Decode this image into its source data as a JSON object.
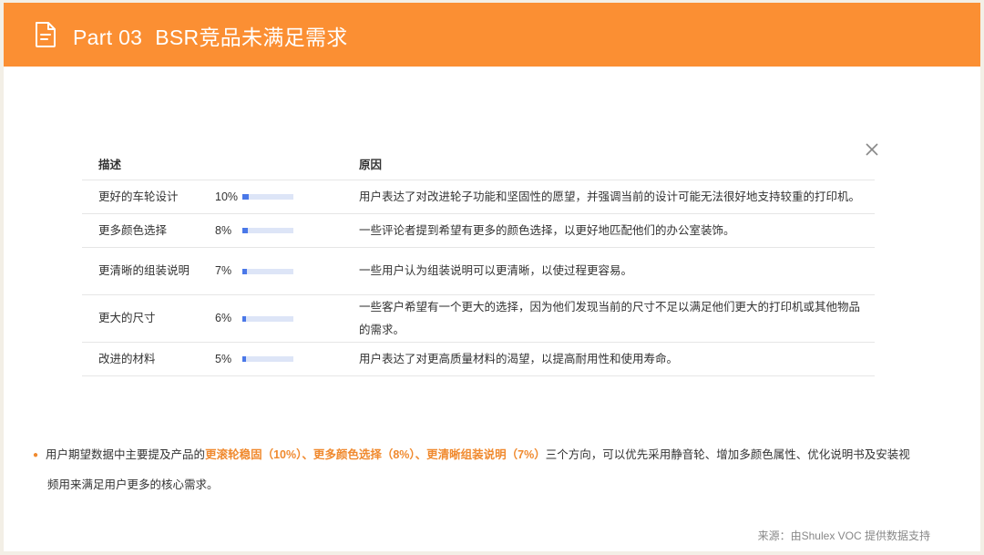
{
  "header": {
    "part_label": "Part 03",
    "title": "BSR竞品未满足需求",
    "icon": "document-icon",
    "background_color": "#fb8f33"
  },
  "table": {
    "headers": {
      "description": "描述",
      "reason": "原因"
    },
    "rows": [
      {
        "description": "更好的车轮设计",
        "percent_text": "10%",
        "percent_value": 10,
        "reason": "用户表达了对改进轮子功能和坚固性的愿望，并强调当前的设计可能无法很好地支持较重的打印机。"
      },
      {
        "description": "更多颜色选择",
        "percent_text": "8%",
        "percent_value": 8,
        "reason": "一些评论者提到希望有更多的颜色选择，以更好地匹配他们的办公室装饰。"
      },
      {
        "description": "更清晰的组装说明",
        "percent_text": "7%",
        "percent_value": 7,
        "reason": "一些用户认为组装说明可以更清晰，以使过程更容易。"
      },
      {
        "description": "更大的尺寸",
        "percent_text": "6%",
        "percent_value": 6,
        "reason": "一些客户希望有一个更大的选择，因为他们发现当前的尺寸不足以满足他们更大的打印机或其他物品的需求。"
      },
      {
        "description": "改进的材料",
        "percent_text": "5%",
        "percent_value": 5,
        "reason": "用户表达了对更高质量材料的渴望，以提高耐用性和使用寿命。"
      }
    ],
    "bar_color": "#4a78e8",
    "bar_track_color": "#dde5f7"
  },
  "close_icon": "close-icon",
  "summary": {
    "text_before": "用户期望数据中主要提及产品的",
    "highlight": "更滚轮稳固（10%）、更多颜色选择（8%）、更清晰组装说明（7%）",
    "text_after_line1": "三个方向，可以优先采用静音轮、增加多颜色属性、优化说明书及安装视",
    "text_line2": "频用来满足用户更多的核心需求。",
    "highlight_color": "#f08a2f"
  },
  "source": "来源：由Shulex VOC 提供数据支持"
}
